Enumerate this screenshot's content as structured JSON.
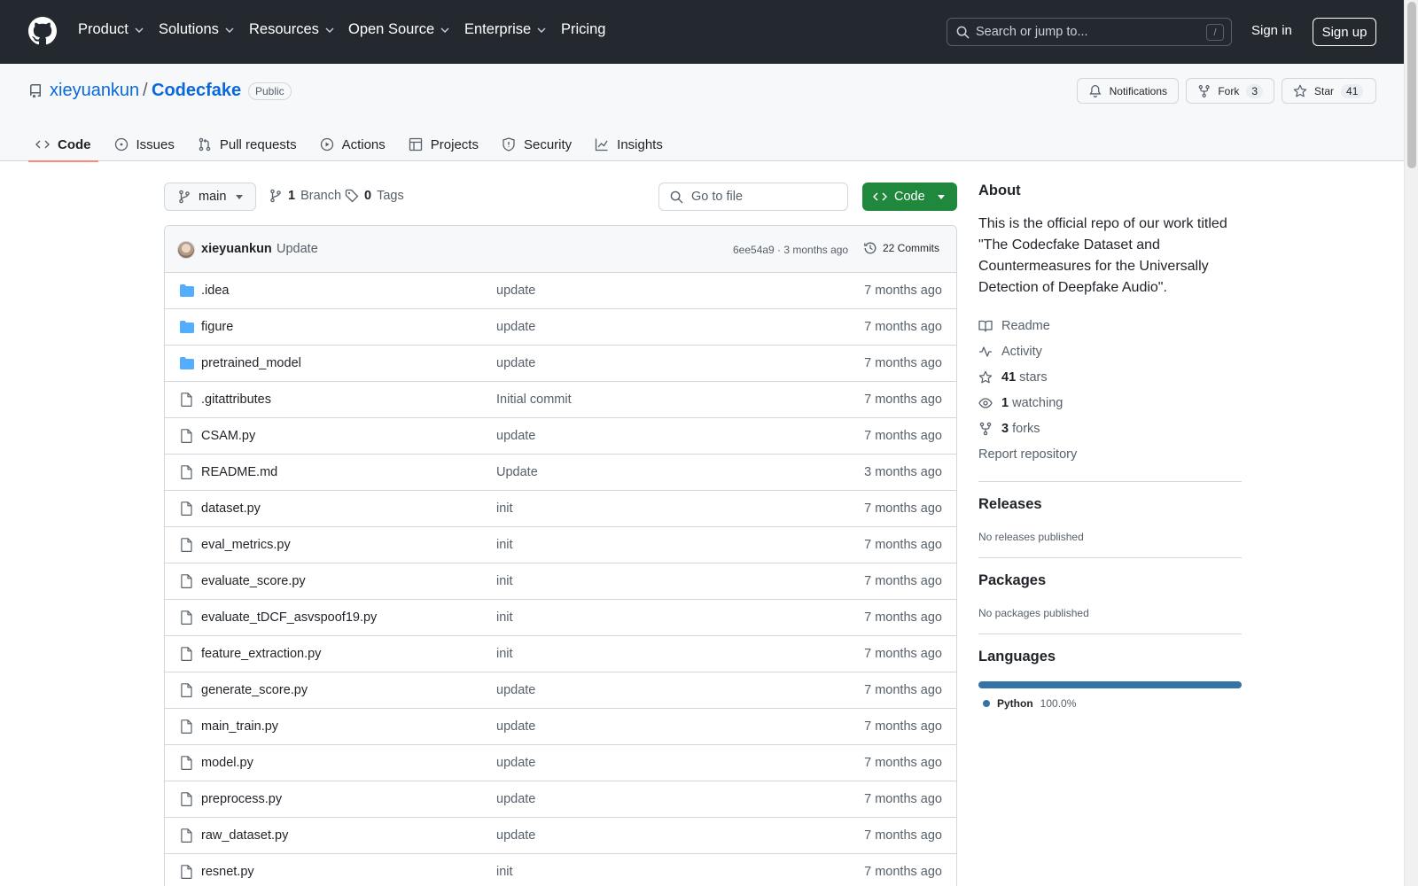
{
  "header": {
    "nav": [
      {
        "label": "Product",
        "dropdown": true
      },
      {
        "label": "Solutions",
        "dropdown": true
      },
      {
        "label": "Resources",
        "dropdown": true
      },
      {
        "label": "Open Source",
        "dropdown": true
      },
      {
        "label": "Enterprise",
        "dropdown": true
      },
      {
        "label": "Pricing",
        "dropdown": false
      }
    ],
    "search_placeholder": "Search or jump to...",
    "search_shortcut": "/",
    "sign_in": "Sign in",
    "sign_up": "Sign up"
  },
  "repo": {
    "owner": "xieyuankun",
    "separator": "/",
    "name": "Codecfake",
    "visibility": "Public",
    "notifications_label": "Notifications",
    "fork_label": "Fork",
    "fork_count": "3",
    "star_label": "Star",
    "star_count": "41",
    "tabs": [
      {
        "label": "Code",
        "icon": "code-icon",
        "active": true
      },
      {
        "label": "Issues",
        "icon": "issue-icon",
        "active": false
      },
      {
        "label": "Pull requests",
        "icon": "pull-request-icon",
        "active": false
      },
      {
        "label": "Actions",
        "icon": "play-icon",
        "active": false
      },
      {
        "label": "Projects",
        "icon": "table-icon",
        "active": false
      },
      {
        "label": "Security",
        "icon": "shield-icon",
        "active": false
      },
      {
        "label": "Insights",
        "icon": "graph-icon",
        "active": false
      }
    ]
  },
  "toolbar": {
    "branch": "main",
    "branch_count": "1",
    "branch_label": "Branch",
    "tag_count": "0",
    "tag_label": "Tags",
    "goto_placeholder": "Go to file",
    "code_label": "Code"
  },
  "commit": {
    "author": "xieyuankun",
    "message": "Update",
    "hash_time": "6ee54a9 · 3 months ago",
    "commits_label": "22 Commits"
  },
  "files": [
    {
      "name": ".idea",
      "type": "folder",
      "message": "update",
      "age": "7 months ago"
    },
    {
      "name": "figure",
      "type": "folder",
      "message": "update",
      "age": "7 months ago"
    },
    {
      "name": "pretrained_model",
      "type": "folder",
      "message": "update",
      "age": "7 months ago"
    },
    {
      "name": ".gitattributes",
      "type": "file",
      "message": "Initial commit",
      "age": "7 months ago"
    },
    {
      "name": "CSAM.py",
      "type": "file",
      "message": "update",
      "age": "7 months ago"
    },
    {
      "name": "README.md",
      "type": "file",
      "message": "Update",
      "age": "3 months ago"
    },
    {
      "name": "dataset.py",
      "type": "file",
      "message": "init",
      "age": "7 months ago"
    },
    {
      "name": "eval_metrics.py",
      "type": "file",
      "message": "init",
      "age": "7 months ago"
    },
    {
      "name": "evaluate_score.py",
      "type": "file",
      "message": "init",
      "age": "7 months ago"
    },
    {
      "name": "evaluate_tDCF_asvspoof19.py",
      "type": "file",
      "message": "init",
      "age": "7 months ago"
    },
    {
      "name": "feature_extraction.py",
      "type": "file",
      "message": "init",
      "age": "7 months ago"
    },
    {
      "name": "generate_score.py",
      "type": "file",
      "message": "update",
      "age": "7 months ago"
    },
    {
      "name": "main_train.py",
      "type": "file",
      "message": "update",
      "age": "7 months ago"
    },
    {
      "name": "model.py",
      "type": "file",
      "message": "update",
      "age": "7 months ago"
    },
    {
      "name": "preprocess.py",
      "type": "file",
      "message": "update",
      "age": "7 months ago"
    },
    {
      "name": "raw_dataset.py",
      "type": "file",
      "message": "update",
      "age": "7 months ago"
    },
    {
      "name": "resnet.py",
      "type": "file",
      "message": "init",
      "age": "7 months ago"
    }
  ],
  "sidebar": {
    "about_title": "About",
    "description": "This is the official repo of our work titled \"The Codecfake Dataset and Countermeasures for the Universally Detection of Deepfake Audio\".",
    "readme": "Readme",
    "activity": "Activity",
    "stars_count": "41",
    "stars_label": "stars",
    "watching_count": "1",
    "watching_label": "watching",
    "forks_count": "3",
    "forks_label": "forks",
    "report": "Report repository",
    "releases_title": "Releases",
    "releases_empty": "No releases published",
    "packages_title": "Packages",
    "packages_empty": "No packages published",
    "languages_title": "Languages",
    "language_name": "Python",
    "language_pct": "100.0%",
    "language_color": "#3572A5"
  }
}
